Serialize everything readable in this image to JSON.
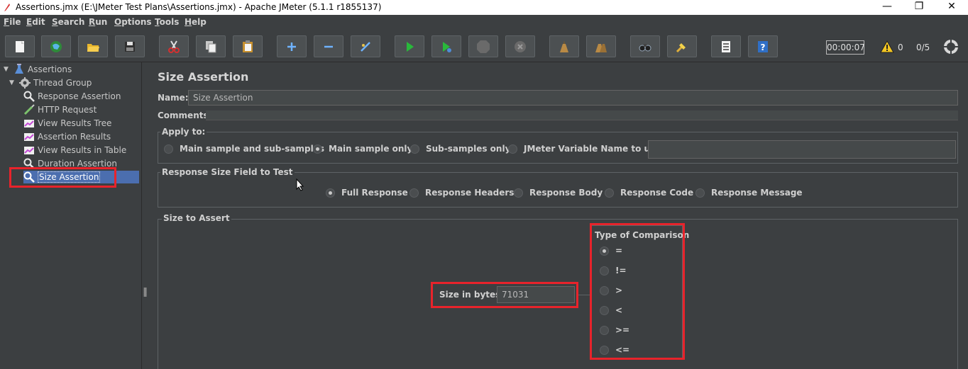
{
  "window": {
    "title": "Assertions.jmx (E:\\JMeter Test Plans\\Assertions.jmx) - Apache JMeter (5.1.1 r1855137)",
    "minimize_glyph": "—",
    "maximize_glyph": "❐",
    "close_glyph": "✕"
  },
  "menubar": [
    {
      "accel": "F",
      "rest": "ile"
    },
    {
      "accel": "E",
      "rest": "dit"
    },
    {
      "accel": "S",
      "rest": "earch"
    },
    {
      "accel": "R",
      "rest": "un"
    },
    {
      "accel": "O",
      "rest": "ptions"
    },
    {
      "accel": "T",
      "rest": "ools"
    },
    {
      "accel": "H",
      "rest": "elp"
    }
  ],
  "toolbar": {
    "buttons": [
      "new-icon",
      "templates-icon",
      "open-icon",
      "save-icon",
      "cut-icon",
      "copy-icon",
      "paste-icon",
      "expand-icon",
      "collapse-icon",
      "toggle-icon",
      "start-icon",
      "start-no-pause-icon",
      "stop-icon",
      "shutdown-icon",
      "clear-icon",
      "clear-all-icon",
      "search-icon",
      "reset-search-icon",
      "function-helper-icon",
      "help-icon"
    ],
    "timer": "00:00:07",
    "warning_count": "0",
    "threads": "0/5",
    "status_icon": "remote-globe-icon"
  },
  "tree": {
    "items": [
      {
        "label": "Assertions",
        "icon": "test-plan-icon"
      },
      {
        "label": "Thread Group",
        "icon": "gear-icon"
      },
      {
        "label": "Response Assertion",
        "icon": "assertion-icon"
      },
      {
        "label": "HTTP Request",
        "icon": "sampler-icon"
      },
      {
        "label": "View Results Tree",
        "icon": "listener-icon"
      },
      {
        "label": "Assertion Results",
        "icon": "listener-icon"
      },
      {
        "label": "View Results in Table",
        "icon": "listener-icon"
      },
      {
        "label": "Duration Assertion",
        "icon": "assertion-icon"
      },
      {
        "label": "Size Assertion",
        "icon": "assertion-icon",
        "selected": true
      }
    ]
  },
  "panel": {
    "title": "Size Assertion",
    "name_label": "Name:",
    "name_value": "Size Assertion",
    "comments_label": "Comments:",
    "apply_to": {
      "legend": "Apply to:",
      "options": [
        "Main sample and sub-samples",
        "Main sample only",
        "Sub-samples only",
        "JMeter Variable Name to use"
      ],
      "selected": 1,
      "variable_value": ""
    },
    "field_to_test": {
      "legend": "Response Size Field to Test",
      "options": [
        "Full Response",
        "Response Headers",
        "Response Body",
        "Response Code",
        "Response Message"
      ],
      "selected": 0
    },
    "size_to_assert": {
      "legend": "Size to Assert",
      "size_label": "Size in bytes:",
      "size_value": "71031",
      "comparison_legend": "Type of Comparison",
      "comparisons": [
        "=",
        "!=",
        ">",
        "<",
        ">=",
        "<="
      ],
      "selected": 0
    }
  },
  "colors": {
    "background": "#3c3f41",
    "selection": "#4b6eaf",
    "highlight_box": "#e8232b"
  }
}
